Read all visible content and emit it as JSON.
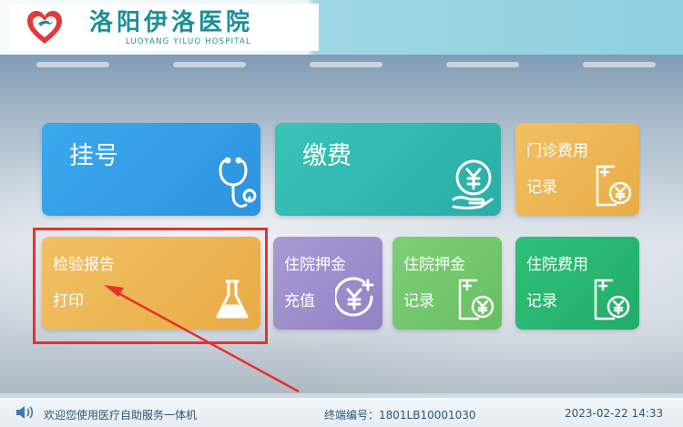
{
  "header": {
    "logo_cn": "洛阳伊洛医院",
    "logo_en": "LUOYANG YILUO HOSPITAL",
    "logo_icon": "heart-bird-logo",
    "colors": {
      "brand": "#1b8f9a",
      "logo_heart": "#e03a3a"
    }
  },
  "tiles": {
    "registration": {
      "label": "挂号",
      "icon": "stethoscope-icon",
      "color": "#3aa9ee"
    },
    "payment": {
      "label": "缴费",
      "icon": "yuan-coin-hand-icon",
      "color": "#38c3b8"
    },
    "outpatient_fee": {
      "line1": "门诊费用",
      "line2": "记录",
      "icon": "yuan-document-icon",
      "color": "#f1c064"
    },
    "lab_report": {
      "line1": "检验报告",
      "line2": "打印",
      "icon": "flask-icon",
      "color": "#f1c064"
    },
    "deposit_topup": {
      "line1": "住院押金",
      "line2": "充值",
      "icon": "yuan-plus-icon",
      "color": "#a89ad4"
    },
    "deposit_record": {
      "line1": "住院押金",
      "line2": "记录",
      "icon": "yuan-document-icon",
      "color": "#7fcf78"
    },
    "inpatient_fee": {
      "line1": "住院费用",
      "line2": "记录",
      "icon": "yuan-document-icon",
      "color": "#2fc07a"
    }
  },
  "annotation": {
    "highlight_color": "#e8312d"
  },
  "footer": {
    "welcome": "欢迎您使用医疗自助服务一体机",
    "terminal": "终端编号：1801LB10001030",
    "datetime": "2023-02-22 14:33",
    "speaker_icon": "speaker-icon"
  }
}
